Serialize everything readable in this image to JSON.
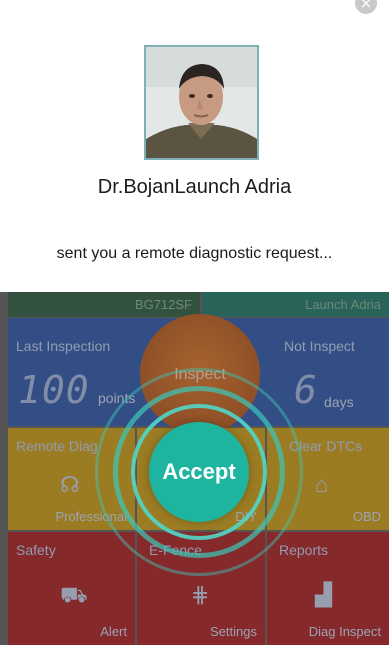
{
  "dialog": {
    "close_icon": "×",
    "caller_name": "Dr.BojanLaunch Adria",
    "request_text": "sent you a remote diagnostic request...",
    "accept_label": "Accept"
  },
  "dashboard": {
    "vehicle_id": "BG712SF",
    "brand": "Launch Adria",
    "inspect_label": "Inspect",
    "last_inspection": {
      "title": "Last Inspection",
      "value": "100",
      "unit": "points"
    },
    "not_inspect": {
      "title": "Not Inspect",
      "value": "6",
      "unit": "days"
    },
    "remote_diag": {
      "title": "Remote Diag",
      "sub": "Professional"
    },
    "diy": {
      "sub": "DIY"
    },
    "clear_dtcs": {
      "title": "Clear DTCs",
      "sub": "OBD"
    },
    "safety": {
      "title": "Safety",
      "sub": "Alert"
    },
    "efence": {
      "title": "E-Fence",
      "sub": "Settings"
    },
    "reports": {
      "title": "Reports",
      "sub": "Diag Inspect"
    }
  },
  "colors": {
    "accept": "#1db5a0",
    "tile_blue": "#1f4aa3",
    "tile_yellow": "#c69405",
    "tile_red": "#a30f10",
    "inspect_orange": "#d96b18"
  }
}
